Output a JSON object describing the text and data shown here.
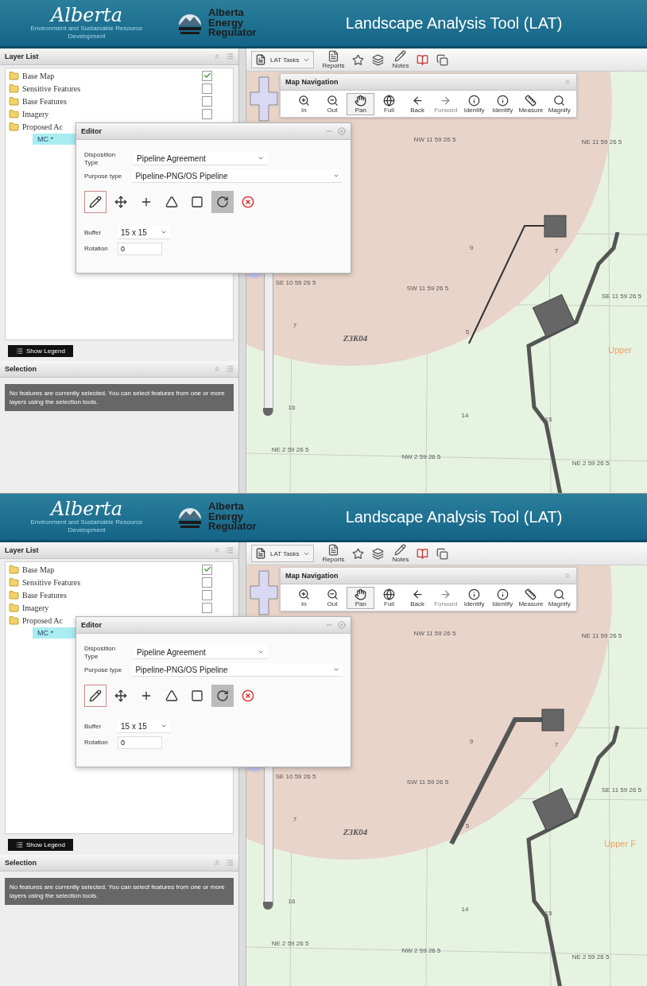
{
  "screens": [
    {
      "header": {
        "ministry_logo": "Alberta",
        "ministry_name": "Environment and Sustainable Resource Development",
        "regulator_name": "Alberta Energy Regulator",
        "title": "Landscape Analysis Tool (LAT)"
      },
      "layer_list": {
        "title": "Layer List",
        "layers": [
          {
            "label": "Base Map",
            "checked": true
          },
          {
            "label": "Sensitive Features",
            "checked": false
          },
          {
            "label": "Base Features",
            "checked": false
          },
          {
            "label": "Imagery",
            "checked": false
          },
          {
            "label": "Proposed Ac",
            "children": [
              {
                "label": "MC *",
                "selected": true
              }
            ]
          }
        ],
        "legend_button": "Show Legend"
      },
      "selection": {
        "title": "Selection",
        "message": "No features are currently selected. You can select features from one or more layers using the selection tools."
      },
      "toolbar": {
        "tasks": "LAT Tasks",
        "buttons": [
          {
            "kind": "reports",
            "label": "Reports"
          },
          {
            "kind": "favorites"
          },
          {
            "kind": "layers"
          },
          {
            "kind": "notes",
            "label": "Notes"
          },
          {
            "kind": "document"
          },
          {
            "kind": "copy"
          }
        ]
      },
      "map_navigation": {
        "title": "Map Navigation",
        "tools": [
          {
            "kind": "zoom-in",
            "label": "In",
            "selected": false,
            "disabled": false
          },
          {
            "kind": "zoom-out",
            "label": "Out",
            "selected": false,
            "disabled": false
          },
          {
            "kind": "pan",
            "label": "Pan",
            "selected": true,
            "disabled": false
          },
          {
            "kind": "full",
            "label": "Full",
            "selected": false,
            "disabled": false
          },
          {
            "kind": "back",
            "label": "Back",
            "selected": false,
            "disabled": false
          },
          {
            "kind": "forward",
            "label": "Forward",
            "selected": false,
            "disabled": true
          },
          {
            "kind": "identify",
            "label": "Identify",
            "selected": false,
            "disabled": false
          },
          {
            "kind": "identify-all",
            "label": "Identify",
            "selected": false,
            "disabled": false
          },
          {
            "kind": "measure",
            "label": "Measure",
            "selected": false,
            "disabled": false
          },
          {
            "kind": "magnify",
            "label": "Magnify",
            "selected": false,
            "disabled": false
          }
        ]
      },
      "editor": {
        "title": "Editor",
        "disposition_label": "Disposition Type",
        "disposition_value": "Pipeline Agreement",
        "purpose_label": "Purpose type",
        "purpose_value": "Pipeline-PNG/OS Pipeline",
        "tools": [
          {
            "kind": "draw",
            "selected": true,
            "pressed": false
          },
          {
            "kind": "move",
            "selected": false,
            "pressed": false
          },
          {
            "kind": "add-vertex",
            "selected": false,
            "pressed": false
          },
          {
            "kind": "vertex",
            "selected": false,
            "pressed": false
          },
          {
            "kind": "reshape",
            "selected": false,
            "pressed": false
          },
          {
            "kind": "rotate",
            "selected": false,
            "pressed": true
          },
          {
            "kind": "delete-vertex",
            "selected": false,
            "pressed": false
          }
        ],
        "buffer_label": "Buffer",
        "buffer_value": "15 x 15",
        "rotation_label": "Rotation",
        "rotation_value": "0"
      },
      "zoom_slider": {
        "level": 0
      },
      "map_labels": [
        "NW 11 59 26 5",
        "NE 11 59 26 5",
        "SE 10 59 26 5",
        "SW 11 59 26 5",
        "SE 11 59 26 5",
        "Z3K04",
        "Upper",
        "NE 2 59 26 5",
        "NW 2 59 26 5",
        "NE 2 59 26 5",
        "9",
        "7",
        "16",
        "14",
        "15",
        "7",
        "5"
      ]
    },
    {
      "header": {
        "ministry_logo": "Alberta",
        "ministry_name": "Environment and Sustainable Resource Development",
        "regulator_name": "Alberta Energy Regulator",
        "title": "Landscape Analysis Tool (LAT)"
      },
      "layer_list": {
        "title": "Layer List",
        "layers": [
          {
            "label": "Base Map",
            "checked": true
          },
          {
            "label": "Sensitive Features",
            "checked": false
          },
          {
            "label": "Base Features",
            "checked": false
          },
          {
            "label": "Imagery",
            "checked": false
          },
          {
            "label": "Proposed Ac",
            "children": [
              {
                "label": "MC *",
                "selected": true
              }
            ]
          }
        ],
        "legend_button": "Show Legend"
      },
      "selection": {
        "title": "Selection",
        "message": "No features are currently selected. You can select features from one or more layers using the selection tools."
      },
      "toolbar": {
        "tasks": "LAT Tasks",
        "buttons": [
          {
            "kind": "reports",
            "label": "Reports"
          },
          {
            "kind": "favorites"
          },
          {
            "kind": "layers"
          },
          {
            "kind": "notes",
            "label": "Notes"
          },
          {
            "kind": "document"
          },
          {
            "kind": "copy"
          }
        ]
      },
      "map_navigation": {
        "title": "Map Navigation",
        "tools": [
          {
            "kind": "zoom-in",
            "label": "In",
            "selected": false,
            "disabled": false
          },
          {
            "kind": "zoom-out",
            "label": "Out",
            "selected": false,
            "disabled": false
          },
          {
            "kind": "pan",
            "label": "Pan",
            "selected": true,
            "disabled": false
          },
          {
            "kind": "full",
            "label": "Full",
            "selected": false,
            "disabled": false
          },
          {
            "kind": "back",
            "label": "Back",
            "selected": false,
            "disabled": false
          },
          {
            "kind": "forward",
            "label": "Forward",
            "selected": false,
            "disabled": true
          },
          {
            "kind": "identify",
            "label": "Identify",
            "selected": false,
            "disabled": false
          },
          {
            "kind": "identify-all",
            "label": "Identify",
            "selected": false,
            "disabled": false
          },
          {
            "kind": "measure",
            "label": "Measure",
            "selected": false,
            "disabled": false
          },
          {
            "kind": "magnify",
            "label": "Magnify",
            "selected": false,
            "disabled": false
          }
        ]
      },
      "editor": {
        "title": "Editor",
        "disposition_label": "Disposition Type",
        "disposition_value": "Pipeline Agreement",
        "purpose_label": "Purpose type",
        "purpose_value": "Pipeline-PNG/OS Pipeline",
        "tools": [
          {
            "kind": "draw",
            "selected": true,
            "pressed": false
          },
          {
            "kind": "move",
            "selected": false,
            "pressed": false
          },
          {
            "kind": "add-vertex",
            "selected": false,
            "pressed": false
          },
          {
            "kind": "vertex",
            "selected": false,
            "pressed": false
          },
          {
            "kind": "reshape",
            "selected": false,
            "pressed": false
          },
          {
            "kind": "rotate",
            "selected": false,
            "pressed": true
          },
          {
            "kind": "delete-vertex",
            "selected": false,
            "pressed": false
          }
        ],
        "buffer_label": "Buffer",
        "buffer_value": "15 x 15",
        "rotation_label": "Rotation",
        "rotation_value": "0"
      },
      "zoom_slider": {
        "level": 0
      },
      "map_labels": [
        "NW 11 59 26 5",
        "NE 11 59 26 5",
        "SE 10 59 26 5",
        "SW 11 59 26 5",
        "SE 11 59 26 5",
        "Z3K04",
        "Upper F",
        "NE 2 59 26 5",
        "NW 2 59 26 5",
        "NE 2 59 26 5",
        "9",
        "7",
        "16",
        "14",
        "15",
        "7",
        "5"
      ]
    }
  ]
}
